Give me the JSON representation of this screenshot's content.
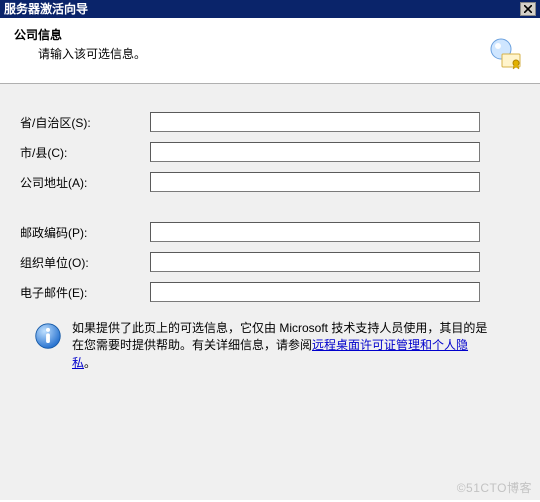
{
  "titlebar": {
    "title": "服务器激活向导"
  },
  "header": {
    "title": "公司信息",
    "subtitle": "请输入该可选信息。"
  },
  "fields": {
    "province": {
      "label": "省/自治区(S):",
      "value": ""
    },
    "city": {
      "label": "市/县(C):",
      "value": ""
    },
    "address": {
      "label": "公司地址(A):",
      "value": ""
    },
    "postal": {
      "label": "邮政编码(P):",
      "value": ""
    },
    "org_unit": {
      "label": "组织单位(O):",
      "value": ""
    },
    "email": {
      "label": "电子邮件(E):",
      "value": ""
    }
  },
  "info": {
    "pre": "如果提供了此页上的可选信息，它仅由 Microsoft 技术支持人员使用，其目的是在您需要时提供帮助。有关详细信息，请参阅",
    "link": "远程桌面许可证管理和个人隐私",
    "post": "。"
  },
  "watermark": "©51CTO博客"
}
